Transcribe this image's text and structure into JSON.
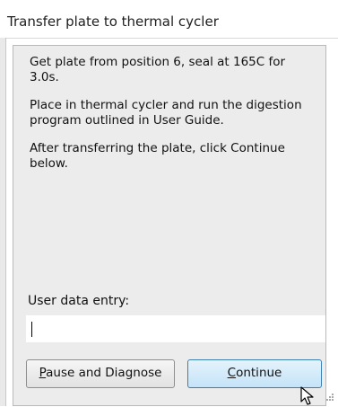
{
  "window": {
    "title": "Transfer plate to thermal cycler"
  },
  "message": {
    "paragraphs": [
      [
        "Get plate from position 6, seal at 165C for",
        "3.0s."
      ],
      [
        "Place in thermal cycler and run the digestion",
        "program outlined in User Guide."
      ],
      [
        "After transferring the plate, click Continue",
        "below."
      ]
    ]
  },
  "entry": {
    "label": "User data entry:",
    "value": ""
  },
  "buttons": {
    "pause": {
      "mnemonic": "P",
      "rest": "ause and Diagnose"
    },
    "continue": {
      "mnemonic": "C",
      "rest": "ontinue"
    }
  },
  "icons": {
    "cursor": "arrow-cursor-icon",
    "resize": "resize-grip-icon"
  }
}
